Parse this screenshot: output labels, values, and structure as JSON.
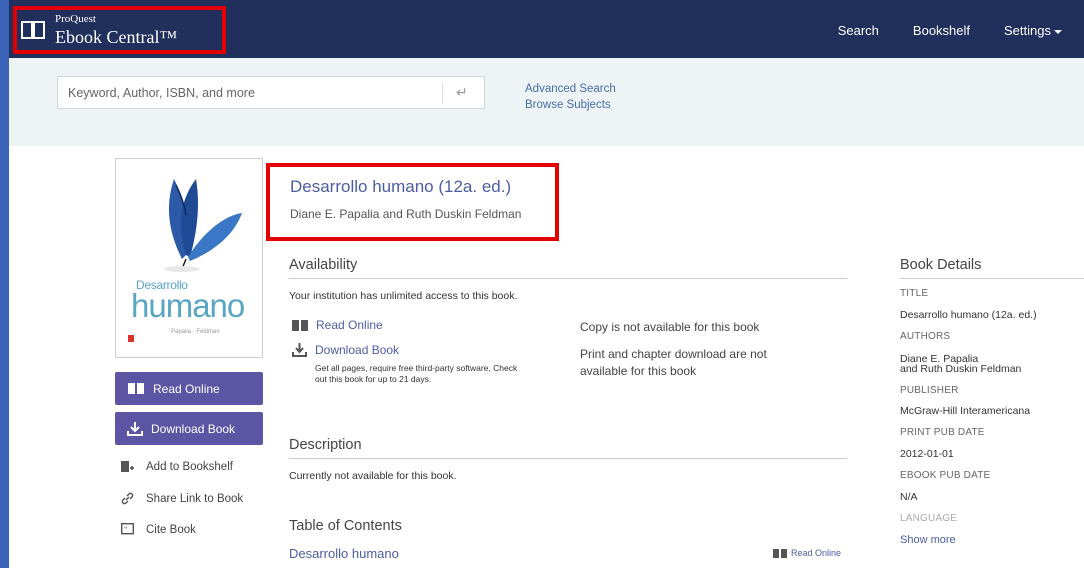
{
  "brand": {
    "sub": "ProQuest",
    "main": "Ebook Central™"
  },
  "nav": {
    "search": "Search",
    "bookshelf": "Bookshelf",
    "settings": "Settings"
  },
  "search": {
    "placeholder": "Keyword, Author, ISBN, and more",
    "advanced": "Advanced Search",
    "browse": "Browse Subjects"
  },
  "cover": {
    "line1": "Desarrollo",
    "line2": "humano",
    "authors": "Papalia · Feldman"
  },
  "left_actions": {
    "read_online": "Read Online",
    "download_book": "Download Book",
    "add_bookshelf": "Add to Bookshelf",
    "share_link": "Share Link to Book",
    "cite": "Cite Book"
  },
  "book": {
    "title": "Desarrollo humano (12a. ed.)",
    "authors": "Diane E. Papalia and Ruth Duskin Feldman"
  },
  "availability": {
    "heading": "Availability",
    "access": "Your institution has unlimited access to this book.",
    "read_online": "Read Online",
    "download_book": "Download Book",
    "download_note_1": "Get all pages, require free third-party software, Check",
    "download_note_2": "out this book for up to 21 days.",
    "copy_status": "Copy is not available for this book",
    "print_status_1": "Print and chapter download are not",
    "print_status_2": "available for this book"
  },
  "description": {
    "heading": "Description",
    "text": "Currently not available for this book."
  },
  "toc": {
    "heading": "Table of Contents",
    "first_item": "Desarrollo humano",
    "read_online": "Read Online"
  },
  "details": {
    "heading": "Book Details",
    "title_label": "TITLE",
    "title_value": "Desarrollo humano (12a. ed.)",
    "authors_label": "AUTHORS",
    "authors_value_1": "Diane E. Papalia",
    "authors_value_2": "and Ruth Duskin Feldman",
    "publisher_label": "PUBLISHER",
    "publisher_value": "McGraw-Hill Interamericana",
    "print_date_label": "PRINT PUB DATE",
    "print_date_value": "2012-01-01",
    "ebook_date_label": "EBOOK PUB DATE",
    "ebook_date_value": "N/A",
    "language_label": "LANGUAGE",
    "show_more": "Show more"
  },
  "colors": {
    "nav_bg": "#212f5c",
    "accent_purple": "#5b55a4",
    "link_blue": "#4d5da3",
    "highlight_red": "#e30000"
  }
}
